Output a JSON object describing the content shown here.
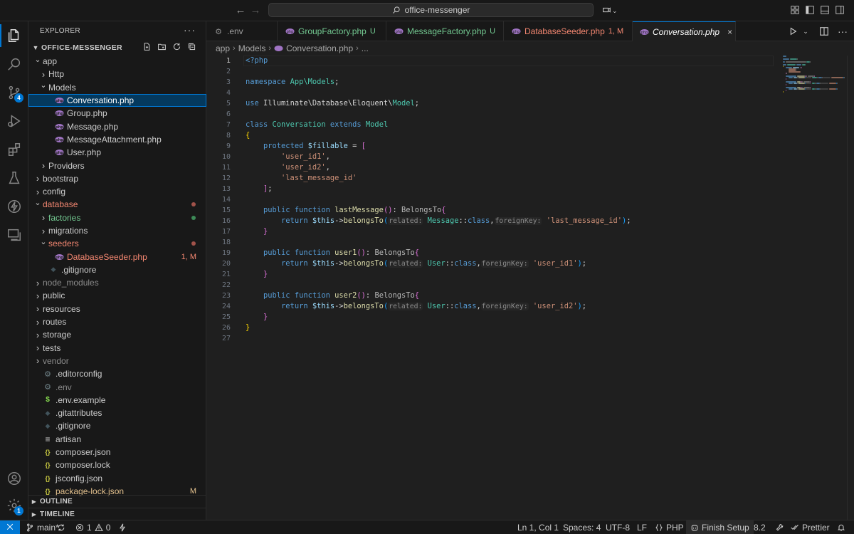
{
  "titlebar": {
    "search_text": "office-messenger"
  },
  "activitybar": {
    "source_control_badge": "4",
    "settings_badge": "1"
  },
  "sidebar": {
    "title": "EXPLORER",
    "more": "···",
    "project": "OFFICE-MESSENGER",
    "tree": [
      {
        "label": "app",
        "depth": 1,
        "chevron": "open",
        "icon": "none",
        "color": "#cccccc"
      },
      {
        "label": "Http",
        "depth": 2,
        "chevron": "closed",
        "icon": "none",
        "color": "#cccccc"
      },
      {
        "label": "Models",
        "depth": 2,
        "chevron": "open",
        "icon": "none",
        "color": "#cccccc"
      },
      {
        "label": "Conversation.php",
        "depth": 3,
        "chevron": "none",
        "icon": "php",
        "color": "#ffffff",
        "selected": true
      },
      {
        "label": "Group.php",
        "depth": 3,
        "chevron": "none",
        "icon": "php",
        "color": "#cccccc"
      },
      {
        "label": "Message.php",
        "depth": 3,
        "chevron": "none",
        "icon": "php",
        "color": "#cccccc"
      },
      {
        "label": "MessageAttachment.php",
        "depth": 3,
        "chevron": "none",
        "icon": "php",
        "color": "#cccccc"
      },
      {
        "label": "User.php",
        "depth": 3,
        "chevron": "none",
        "icon": "php",
        "color": "#cccccc"
      },
      {
        "label": "Providers",
        "depth": 2,
        "chevron": "closed",
        "icon": "none",
        "color": "#cccccc"
      },
      {
        "label": "bootstrap",
        "depth": 1,
        "chevron": "closed",
        "icon": "none",
        "color": "#cccccc"
      },
      {
        "label": "config",
        "depth": 1,
        "chevron": "closed",
        "icon": "none",
        "color": "#cccccc"
      },
      {
        "label": "database",
        "depth": 1,
        "chevron": "open",
        "icon": "none",
        "color": "#f48771",
        "dot": "#a1524a"
      },
      {
        "label": "factories",
        "depth": 2,
        "chevron": "closed",
        "icon": "none",
        "color": "#73c991",
        "dot": "#3d8a57"
      },
      {
        "label": "migrations",
        "depth": 2,
        "chevron": "closed",
        "icon": "none",
        "color": "#cccccc"
      },
      {
        "label": "seeders",
        "depth": 2,
        "chevron": "open",
        "icon": "none",
        "color": "#f48771",
        "dot": "#a1524a"
      },
      {
        "label": "DatabaseSeeder.php",
        "depth": 3,
        "chevron": "none",
        "icon": "php",
        "color": "#f48771",
        "deco": "1, M"
      },
      {
        "label": ".gitignore",
        "depth": 2,
        "chevron": "none",
        "icon": "gitdot",
        "color": "#cccccc"
      },
      {
        "label": "node_modules",
        "depth": 1,
        "chevron": "closed",
        "icon": "none",
        "color": "#8c8c8c"
      },
      {
        "label": "public",
        "depth": 1,
        "chevron": "closed",
        "icon": "none",
        "color": "#cccccc"
      },
      {
        "label": "resources",
        "depth": 1,
        "chevron": "closed",
        "icon": "none",
        "color": "#cccccc"
      },
      {
        "label": "routes",
        "depth": 1,
        "chevron": "closed",
        "icon": "none",
        "color": "#cccccc"
      },
      {
        "label": "storage",
        "depth": 1,
        "chevron": "closed",
        "icon": "none",
        "color": "#cccccc"
      },
      {
        "label": "tests",
        "depth": 1,
        "chevron": "closed",
        "icon": "none",
        "color": "#cccccc"
      },
      {
        "label": "vendor",
        "depth": 1,
        "chevron": "closed",
        "icon": "none",
        "color": "#8c8c8c"
      },
      {
        "label": ".editorconfig",
        "depth": 1,
        "chevron": "none",
        "icon": "gear",
        "color": "#cccccc"
      },
      {
        "label": ".env",
        "depth": 1,
        "chevron": "none",
        "icon": "gear",
        "color": "#8c8c8c"
      },
      {
        "label": ".env.example",
        "depth": 1,
        "chevron": "none",
        "icon": "dollar",
        "color": "#cccccc"
      },
      {
        "label": ".gitattributes",
        "depth": 1,
        "chevron": "none",
        "icon": "gitdot",
        "color": "#cccccc"
      },
      {
        "label": ".gitignore",
        "depth": 1,
        "chevron": "none",
        "icon": "gitdot",
        "color": "#cccccc"
      },
      {
        "label": "artisan",
        "depth": 1,
        "chevron": "none",
        "icon": "lines",
        "color": "#cccccc"
      },
      {
        "label": "composer.json",
        "depth": 1,
        "chevron": "none",
        "icon": "braces",
        "color": "#cccccc"
      },
      {
        "label": "composer.lock",
        "depth": 1,
        "chevron": "none",
        "icon": "braces",
        "color": "#cccccc"
      },
      {
        "label": "jsconfig.json",
        "depth": 1,
        "chevron": "none",
        "icon": "braces",
        "color": "#cccccc"
      },
      {
        "label": "package-lock.json",
        "depth": 1,
        "chevron": "none",
        "icon": "braces",
        "color": "#e2c08d",
        "deco": "M"
      }
    ],
    "outline": "OUTLINE",
    "timeline": "TIMELINE"
  },
  "tabs": [
    {
      "label": ".env",
      "status": "",
      "icon": "gear",
      "color": "#9d9d9d",
      "status_color": "",
      "active": false
    },
    {
      "label": "GroupFactory.php",
      "status": "U",
      "icon": "php",
      "color": "#73c991",
      "status_color": "#73c991",
      "active": false
    },
    {
      "label": "MessageFactory.php",
      "status": "U",
      "icon": "php",
      "color": "#73c991",
      "status_color": "#73c991",
      "active": false
    },
    {
      "label": "DatabaseSeeder.php",
      "status": "1, M",
      "icon": "php",
      "color": "#f48771",
      "status_color": "#f48771",
      "active": false
    },
    {
      "label": "Conversation.php",
      "status": "",
      "icon": "php",
      "color": "#ffffff",
      "status_color": "",
      "active": true,
      "close": "×"
    }
  ],
  "breadcrumb": [
    "app",
    "Models",
    "Conversation.php",
    "..."
  ],
  "editor": {
    "current_line": 1,
    "lines": [
      [
        [
          "ph",
          "<?php"
        ]
      ],
      [],
      [
        [
          "kw",
          "namespace "
        ],
        [
          "ns",
          "App\\Models"
        ],
        [
          "op",
          ";"
        ]
      ],
      [],
      [
        [
          "kw",
          "use "
        ],
        [
          "op",
          "Illuminate\\Database\\Eloquent\\"
        ],
        [
          "cls",
          "Model"
        ],
        [
          "op",
          ";"
        ]
      ],
      [],
      [
        [
          "kw",
          "class "
        ],
        [
          "cls",
          "Conversation "
        ],
        [
          "kw",
          "extends "
        ],
        [
          "cls",
          "Model"
        ]
      ],
      [
        [
          "br1",
          "{"
        ]
      ],
      [
        [
          "op",
          "    "
        ],
        [
          "kw",
          "protected "
        ],
        [
          "var",
          "$fillable"
        ],
        [
          "op",
          " = "
        ],
        [
          "br2",
          "["
        ]
      ],
      [
        [
          "op",
          "        "
        ],
        [
          "str",
          "'user_id1'"
        ],
        [
          "op",
          ","
        ]
      ],
      [
        [
          "op",
          "        "
        ],
        [
          "str",
          "'user_id2'"
        ],
        [
          "op",
          ","
        ]
      ],
      [
        [
          "op",
          "        "
        ],
        [
          "str",
          "'last_message_id'"
        ]
      ],
      [
        [
          "op",
          "    "
        ],
        [
          "br2",
          "]"
        ],
        [
          "op",
          ";"
        ]
      ],
      [],
      [
        [
          "op",
          "    "
        ],
        [
          "kw",
          "public function "
        ],
        [
          "fn",
          "lastMessage"
        ],
        [
          "br2",
          "()"
        ],
        [
          "op",
          ": "
        ],
        [
          "rt",
          "BelongsTo"
        ],
        [
          "br2",
          "{"
        ]
      ],
      [
        [
          "op",
          "        "
        ],
        [
          "kw",
          "return "
        ],
        [
          "var",
          "$this"
        ],
        [
          "op",
          "->"
        ],
        [
          "fn",
          "belongsTo"
        ],
        [
          "br3",
          "("
        ],
        [
          "hint",
          "related:"
        ],
        [
          "op",
          " "
        ],
        [
          "cls",
          "Message"
        ],
        [
          "op",
          "::"
        ],
        [
          "kw",
          "class"
        ],
        [
          "op",
          ","
        ],
        [
          "hint",
          "foreignKey:"
        ],
        [
          "op",
          " "
        ],
        [
          "str",
          "'last_message_id'"
        ],
        [
          "br3",
          ")"
        ],
        [
          "op",
          ";"
        ]
      ],
      [
        [
          "op",
          "    "
        ],
        [
          "br2",
          "}"
        ]
      ],
      [],
      [
        [
          "op",
          "    "
        ],
        [
          "kw",
          "public function "
        ],
        [
          "fn",
          "user1"
        ],
        [
          "br2",
          "()"
        ],
        [
          "op",
          ": "
        ],
        [
          "rt",
          "BelongsTo"
        ],
        [
          "br2",
          "{"
        ]
      ],
      [
        [
          "op",
          "        "
        ],
        [
          "kw",
          "return "
        ],
        [
          "var",
          "$this"
        ],
        [
          "op",
          "->"
        ],
        [
          "fn",
          "belongsTo"
        ],
        [
          "br3",
          "("
        ],
        [
          "hint",
          "related:"
        ],
        [
          "op",
          " "
        ],
        [
          "cls",
          "User"
        ],
        [
          "op",
          "::"
        ],
        [
          "kw",
          "class"
        ],
        [
          "op",
          ","
        ],
        [
          "hint",
          "foreignKey:"
        ],
        [
          "op",
          " "
        ],
        [
          "str",
          "'user_id1'"
        ],
        [
          "br3",
          ")"
        ],
        [
          "op",
          ";"
        ]
      ],
      [
        [
          "op",
          "    "
        ],
        [
          "br2",
          "}"
        ]
      ],
      [],
      [
        [
          "op",
          "    "
        ],
        [
          "kw",
          "public function "
        ],
        [
          "fn",
          "user2"
        ],
        [
          "br2",
          "()"
        ],
        [
          "op",
          ": "
        ],
        [
          "rt",
          "BelongsTo"
        ],
        [
          "br2",
          "{"
        ]
      ],
      [
        [
          "op",
          "        "
        ],
        [
          "kw",
          "return "
        ],
        [
          "var",
          "$this"
        ],
        [
          "op",
          "->"
        ],
        [
          "fn",
          "belongsTo"
        ],
        [
          "br3",
          "("
        ],
        [
          "hint",
          "related:"
        ],
        [
          "op",
          " "
        ],
        [
          "cls",
          "User"
        ],
        [
          "op",
          "::"
        ],
        [
          "kw",
          "class"
        ],
        [
          "op",
          ","
        ],
        [
          "hint",
          "foreignKey:"
        ],
        [
          "op",
          " "
        ],
        [
          "str",
          "'user_id2'"
        ],
        [
          "br3",
          ")"
        ],
        [
          "op",
          ";"
        ]
      ],
      [
        [
          "op",
          "    "
        ],
        [
          "br2",
          "}"
        ]
      ],
      [
        [
          "br1",
          "}"
        ]
      ],
      []
    ]
  },
  "statusbar": {
    "branch": "main*",
    "errors": "1",
    "warnings": "0",
    "position": "Ln 1, Col 1",
    "spaces": "Spaces: 4",
    "encoding": "UTF-8",
    "eol": "LF",
    "language": "PHP",
    "finish_setup": "Finish Setup",
    "php_version": "8.2",
    "prettier": "Prettier"
  },
  "colors": {
    "accent": "#0078d4",
    "php_icon": "#a074c4",
    "modified": "#e2c08d",
    "untracked": "#73c991",
    "error": "#f48771"
  }
}
